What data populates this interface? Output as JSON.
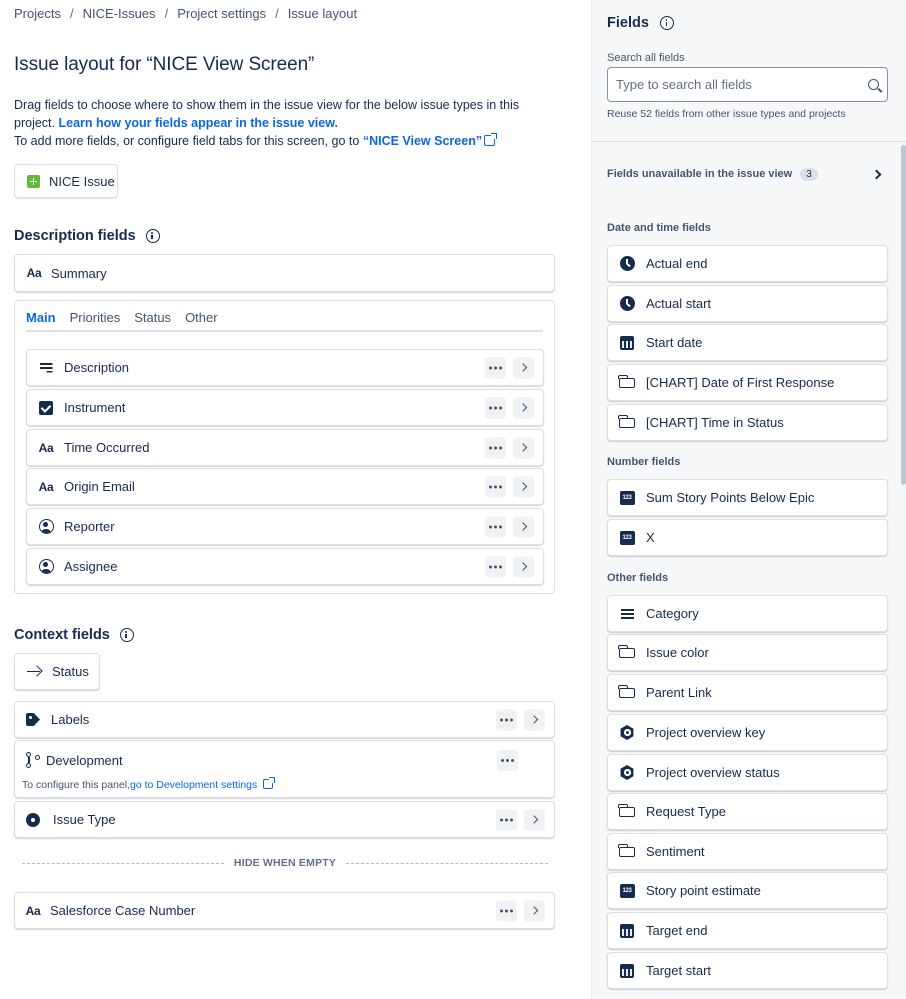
{
  "breadcrumbs": [
    "Projects",
    "NICE-Issues",
    "Project settings",
    "Issue layout"
  ],
  "page": {
    "title": "Issue layout for “NICE View Screen”",
    "intro_text": "Drag fields to choose where to show them in the issue view for the below issue types in this project.",
    "intro_link": "Learn how your fields appear in the issue view.",
    "add_more_text": "To add more fields, or configure field tabs for this screen, go to",
    "screen_link": "“NICE View Screen”",
    "issue_type_button": "NICE Issue"
  },
  "description_section": {
    "heading": "Description fields",
    "summary": "Summary",
    "tabs": [
      "Main",
      "Priorities",
      "Status",
      "Other"
    ],
    "fields": [
      {
        "label": "Description",
        "icon": "lines-icon"
      },
      {
        "label": "Instrument",
        "icon": "checkbox-icon"
      },
      {
        "label": "Time Occurred",
        "icon": "text-icon"
      },
      {
        "label": "Origin Email",
        "icon": "text-icon"
      },
      {
        "label": "Reporter",
        "icon": "person-icon"
      },
      {
        "label": "Assignee",
        "icon": "person-icon"
      }
    ]
  },
  "context_section": {
    "heading": "Context fields",
    "status": "Status",
    "labels": "Labels",
    "development": "Development",
    "dev_note": "To configure this panel,",
    "dev_link": "go to Development settings",
    "issue_type": "Issue Type",
    "hide_when_empty": "HIDE WHEN EMPTY",
    "salesforce": "Salesforce Case Number"
  },
  "fields_panel": {
    "heading": "Fields",
    "search_label": "Search all fields",
    "search_placeholder": "Type to search all fields",
    "reuse_text": "Reuse 52 fields from other issue types and projects",
    "unavailable_label": "Fields unavailable in the issue view",
    "unavailable_count": "3",
    "groups": [
      {
        "name": "Date and time fields",
        "items": [
          {
            "label": "Actual end",
            "icon": "clock-icon"
          },
          {
            "label": "Actual start",
            "icon": "clock-icon"
          },
          {
            "label": "Start date",
            "icon": "calendar-icon"
          },
          {
            "label": "[CHART] Date of First Response",
            "icon": "field-box-icon"
          },
          {
            "label": "[CHART] Time in Status",
            "icon": "field-box-icon"
          }
        ]
      },
      {
        "name": "Number fields",
        "items": [
          {
            "label": "Sum Story Points Below Epic",
            "icon": "number-icon"
          },
          {
            "label": "X",
            "icon": "number-icon"
          }
        ]
      },
      {
        "name": "Other fields",
        "items": [
          {
            "label": "Category",
            "icon": "list-icon"
          },
          {
            "label": "Issue color",
            "icon": "field-box-icon"
          },
          {
            "label": "Parent Link",
            "icon": "field-box-icon"
          },
          {
            "label": "Project overview key",
            "icon": "hexagon-icon"
          },
          {
            "label": "Project overview status",
            "icon": "hexagon-icon"
          },
          {
            "label": "Request Type",
            "icon": "field-box-icon"
          },
          {
            "label": "Sentiment",
            "icon": "field-box-icon"
          },
          {
            "label": "Story point estimate",
            "icon": "number-icon"
          },
          {
            "label": "Target end",
            "icon": "calendar-icon"
          },
          {
            "label": "Target start",
            "icon": "calendar-icon"
          }
        ]
      }
    ]
  },
  "colors": {
    "link": "#0c66e4",
    "text": "#172b4d",
    "panel_bg": "#f7f8f9",
    "issue_icon": "#63ba3c"
  }
}
